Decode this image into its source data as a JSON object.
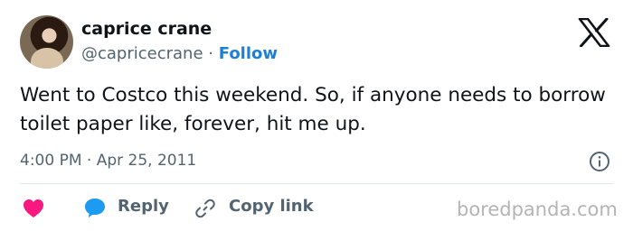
{
  "author": {
    "name": "caprice crane",
    "handle": "@capricecrane",
    "separator": "·",
    "follow_label": "Follow"
  },
  "tweet": {
    "text": "Went to Costco this weekend. So, if anyone needs to borrow toilet paper like, forever, hit me up.",
    "timestamp": "4:00 PM · Apr 25, 2011"
  },
  "actions": {
    "reply_label": "Reply",
    "copy_link_label": "Copy link"
  },
  "watermark": "boredpanda.com",
  "icons": {
    "platform": "x-logo-icon",
    "info": "info-icon",
    "like": "heart-icon",
    "reply": "speech-bubble-icon",
    "copy": "link-icon"
  },
  "colors": {
    "follow": "#1d7fd6",
    "heart": "#f91880",
    "reply_bubble": "#1d9bf0",
    "secondary_text": "#536471",
    "watermark": "#b4b4b4"
  }
}
